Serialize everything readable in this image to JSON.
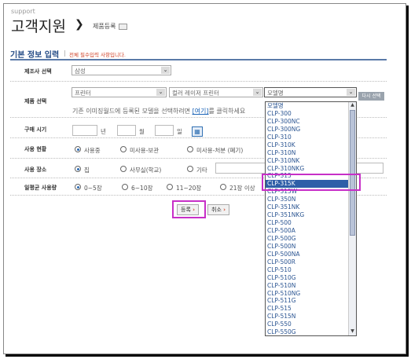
{
  "header": {
    "support": "support",
    "title": "고객지원",
    "arrow": "❯",
    "breadcrumb": "제품등록"
  },
  "section": {
    "title": "기본 정보 입력",
    "note": "전체 필수입력 사항입니다."
  },
  "maker": {
    "label": "제조사 선택",
    "value": "삼성"
  },
  "product": {
    "label": "제품 선택",
    "type": "프린터",
    "sub": "컬러 레이저 프린터",
    "model": "모델명",
    "reselect": "다시 선택",
    "note_pre": "기존 이미징월드에 등록된 모델을 선택하려면",
    "note_link": "[여기]",
    "note_post": "를 클릭하세요"
  },
  "purchase": {
    "label": "구매 시기",
    "year": "년",
    "month": "월",
    "day": "일"
  },
  "usage": {
    "label": "사용 현황",
    "opt1": "사용중",
    "opt2": "미사용-보관",
    "opt3": "미사용-처분 (폐기)"
  },
  "place": {
    "label": "사용 장소",
    "opt1": "집",
    "opt2": "사무실(학교)",
    "opt3": "기타"
  },
  "daily": {
    "label": "일평균 사용량",
    "opt1": "0~5장",
    "opt2": "6~10장",
    "opt3": "11~20장",
    "opt4": "21장 이상"
  },
  "buttons": {
    "register": "등록",
    "cancel": "취소",
    "mark": "›"
  },
  "models": [
    "모델명",
    "CLP-300",
    "CLP-300NC",
    "CLP-300NG",
    "CLP-310",
    "CLP-310K",
    "CLP-310N",
    "CLP-310NK",
    "CLP-310NKG",
    "CLP-315",
    "CLP-315K",
    "CLP-315W",
    "CLP-350N",
    "CLP-351NK",
    "CLP-351NKG",
    "CLP-500",
    "CLP-500A",
    "CLP-500G",
    "CLP-500N",
    "CLP-500NA",
    "CLP-500R",
    "CLP-510",
    "CLP-510G",
    "CLP-510N",
    "CLP-510NG",
    "CLP-511G",
    "CLP-515",
    "CLP-515N",
    "CLP-550",
    "CLP-550G"
  ],
  "selected_model": "CLP-315K"
}
